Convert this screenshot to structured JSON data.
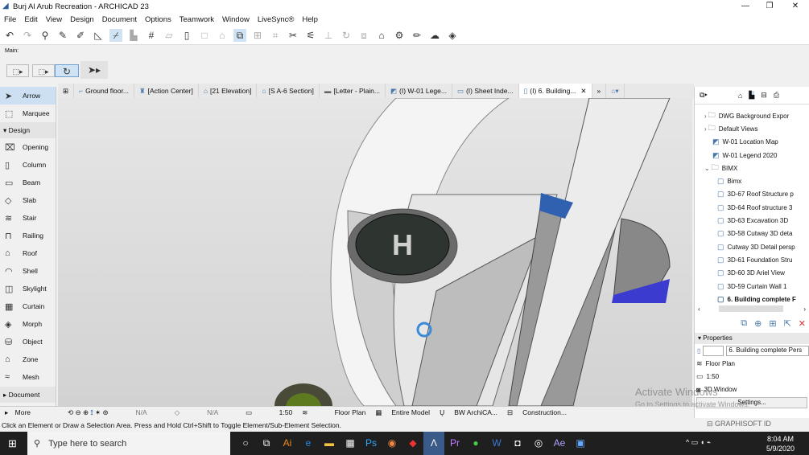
{
  "window": {
    "title": "Burj Al Arub Recreation - ARCHICAD 23"
  },
  "menu": [
    "File",
    "Edit",
    "View",
    "Design",
    "Document",
    "Options",
    "Teamwork",
    "Window",
    "LiveSync®",
    "Help"
  ],
  "main_label": "Main:",
  "tabs": [
    {
      "label": "Ground floor...",
      "icon": "floor-plan-icon"
    },
    {
      "label": "[Action Center]",
      "icon": "action-center-icon"
    },
    {
      "label": "[21 Elevation]",
      "icon": "elevation-icon"
    },
    {
      "label": "[S A-6 Section]",
      "icon": "section-icon"
    },
    {
      "label": "[Letter - Plain...",
      "icon": "layout-icon"
    },
    {
      "label": "(I) W-01 Lege...",
      "icon": "drawing-icon"
    },
    {
      "label": "(I) Sheet Inde...",
      "icon": "sheet-icon"
    },
    {
      "label": "(I) 6. Building...",
      "icon": "3d-icon",
      "active": true
    }
  ],
  "toolbox": {
    "top": [
      {
        "label": "Arrow",
        "selected": true
      },
      {
        "label": "Marquee"
      }
    ],
    "design_header": "Design",
    "design": [
      "Opening",
      "Column",
      "Beam",
      "Slab",
      "Stair",
      "Railing",
      "Roof",
      "Shell",
      "Skylight",
      "Curtain",
      "Morph",
      "Object",
      "Zone",
      "Mesh"
    ],
    "document_header": "Document",
    "more": "More"
  },
  "navigator": {
    "items": [
      {
        "label": "DWG Background Expor",
        "type": "folder",
        "level": 1
      },
      {
        "label": "Default Views",
        "type": "folder",
        "level": 1
      },
      {
        "label": "W-01 Location Map",
        "type": "drawing",
        "level": 1
      },
      {
        "label": "W-01 Legend 2020",
        "type": "drawing",
        "level": 1
      },
      {
        "label": "BIMX",
        "type": "folder-open",
        "level": 1
      },
      {
        "label": "Bimx",
        "type": "3d",
        "level": 2
      },
      {
        "label": "3D-67 Roof Structure p",
        "type": "3d",
        "level": 2
      },
      {
        "label": "3D-64 Roof structure 3",
        "type": "3d",
        "level": 2
      },
      {
        "label": "3D-63 Excavation 3D",
        "type": "3d",
        "level": 2
      },
      {
        "label": "3D-58 Cutway 3D deta",
        "type": "3d",
        "level": 2
      },
      {
        "label": "Cutway 3D Detail persp",
        "type": "3d",
        "level": 2
      },
      {
        "label": "3D-61 Foundation Stru",
        "type": "3d",
        "level": 2
      },
      {
        "label": "3D-60 3D Ariel View",
        "type": "3d",
        "level": 2
      },
      {
        "label": "3D-59 Curtain Wall 1",
        "type": "3d",
        "level": 2
      },
      {
        "label": "6. Building complete F",
        "type": "3d",
        "level": 2,
        "bold": true
      }
    ]
  },
  "properties": {
    "header": "Properties",
    "id_value": "",
    "name": "6. Building complete Pers",
    "view": "Floor Plan",
    "scale": "1:50",
    "type": "3D Window",
    "settings": "Settings..."
  },
  "bottombar": {
    "zoom1": "N/A",
    "zoom2": "N/A",
    "scale": "1:50",
    "layer": "Floor Plan",
    "model": "Entire Model",
    "pen": "BW ArchiCA...",
    "structure": "Construction..."
  },
  "status": "Click an Element or Draw a Selection Area. Press and Hold Ctrl+Shift to Toggle Element/Sub-Element Selection.",
  "watermark": {
    "line1": "Activate Windows",
    "line2": "Go to Settings to activate Windows.",
    "brand": "GRAPHISOFT ID"
  },
  "taskbar": {
    "search_placeholder": "Type here to search",
    "time": "8:04 AM",
    "date": "5/9/2020"
  }
}
